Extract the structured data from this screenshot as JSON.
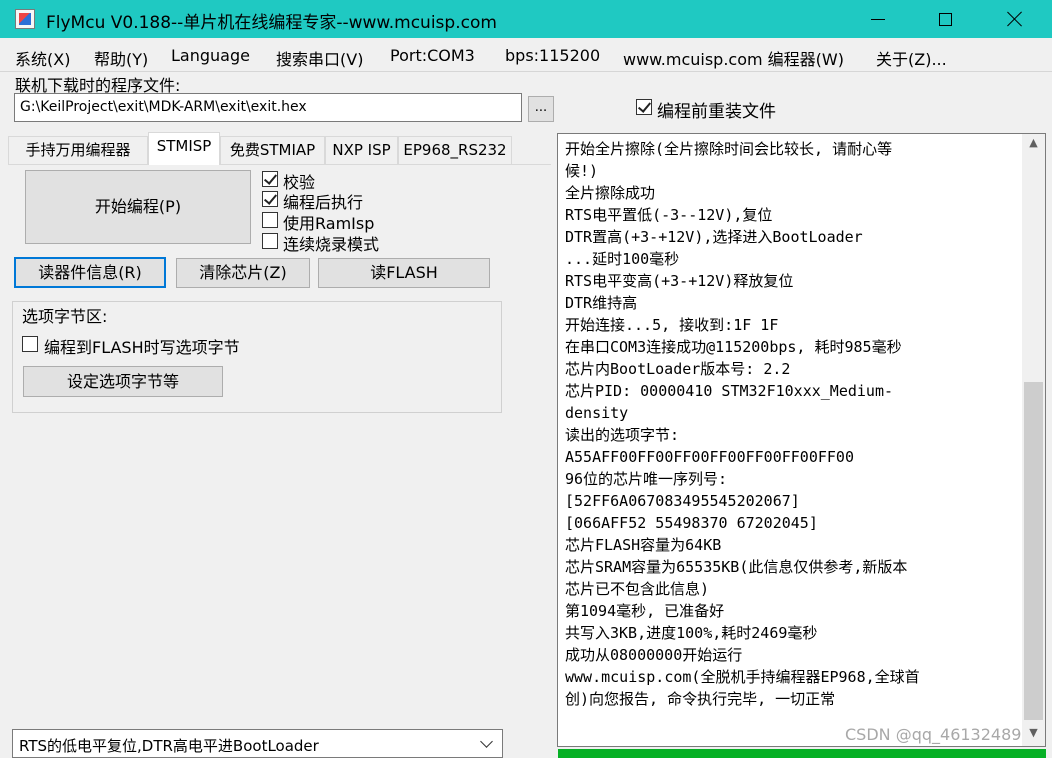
{
  "window": {
    "title": "FlyMcu V0.188--单片机在线编程专家--www.mcuisp.com",
    "title_bar_color": "#1fc9c2"
  },
  "menu": [
    "系统(X)",
    "帮助(Y)",
    "Language",
    "搜索串口(V)",
    "Port:COM3",
    "bps:115200",
    "www.mcuisp.com 编程器(W)",
    "关于(Z)..."
  ],
  "file": {
    "label": "联机下载时的程序文件:",
    "path": "G:\\KeilProject\\exit\\MDK-ARM\\exit\\exit.hex",
    "browse_label": "...",
    "reload_label": "编程前重装文件",
    "reload_checked": true
  },
  "tabs": [
    "手持万用编程器",
    "STMISP",
    "免费STMIAP",
    "NXP ISP",
    "EP968_RS232"
  ],
  "active_tab": "STMISP",
  "program_button": "开始编程(P)",
  "options": [
    {
      "label": "校验",
      "checked": true
    },
    {
      "label": "编程后执行",
      "checked": true
    },
    {
      "label": "使用RamIsp",
      "checked": false
    },
    {
      "label": "连续烧录模式",
      "checked": false
    }
  ],
  "actions": {
    "read_info": "读器件信息(R)",
    "erase_chip": "清除芯片(Z)",
    "read_flash": "读FLASH"
  },
  "option_bytes": {
    "group_title": "选项字节区:",
    "write_label": "编程到FLASH时写选项字节",
    "write_checked": false,
    "set_button": "设定选项字节等"
  },
  "reset_mode": "RTS的低电平复位,DTR高电平进BootLoader",
  "log": [
    "开始全片擦除(全片擦除时间会比较长, 请耐心等",
    "候!)",
    "全片擦除成功",
    "RTS电平置低(-3--12V),复位",
    "DTR置高(+3-+12V),选择进入BootLoader",
    "...延时100毫秒",
    "RTS电平变高(+3-+12V)释放复位",
    "DTR维持高",
    "开始连接...5, 接收到:1F 1F",
    "在串口COM3连接成功@115200bps, 耗时985毫秒",
    "芯片内BootLoader版本号: 2.2",
    "芯片PID: 00000410  STM32F10xxx_Medium-",
    "density",
    "读出的选项字节:",
    "A55AFF00FF00FF00FF00FF00FF00FF00",
    "96位的芯片唯一序列号:",
    "[52FF6A067083495545202067]",
    "[066AFF52 55498370 67202045]",
    "芯片FLASH容量为64KB",
    "芯片SRAM容量为65535KB(此信息仅供参考,新版本",
    "芯片已不包含此信息)",
    "第1094毫秒, 已准备好",
    "共写入3KB,进度100%,耗时2469毫秒",
    "成功从08000000开始运行",
    "www.mcuisp.com(全脱机手持编程器EP968,全球首",
    "创)向您报告, 命令执行完毕, 一切正常"
  ],
  "progress": 1.0,
  "watermark": "CSDN @qq_46132489"
}
